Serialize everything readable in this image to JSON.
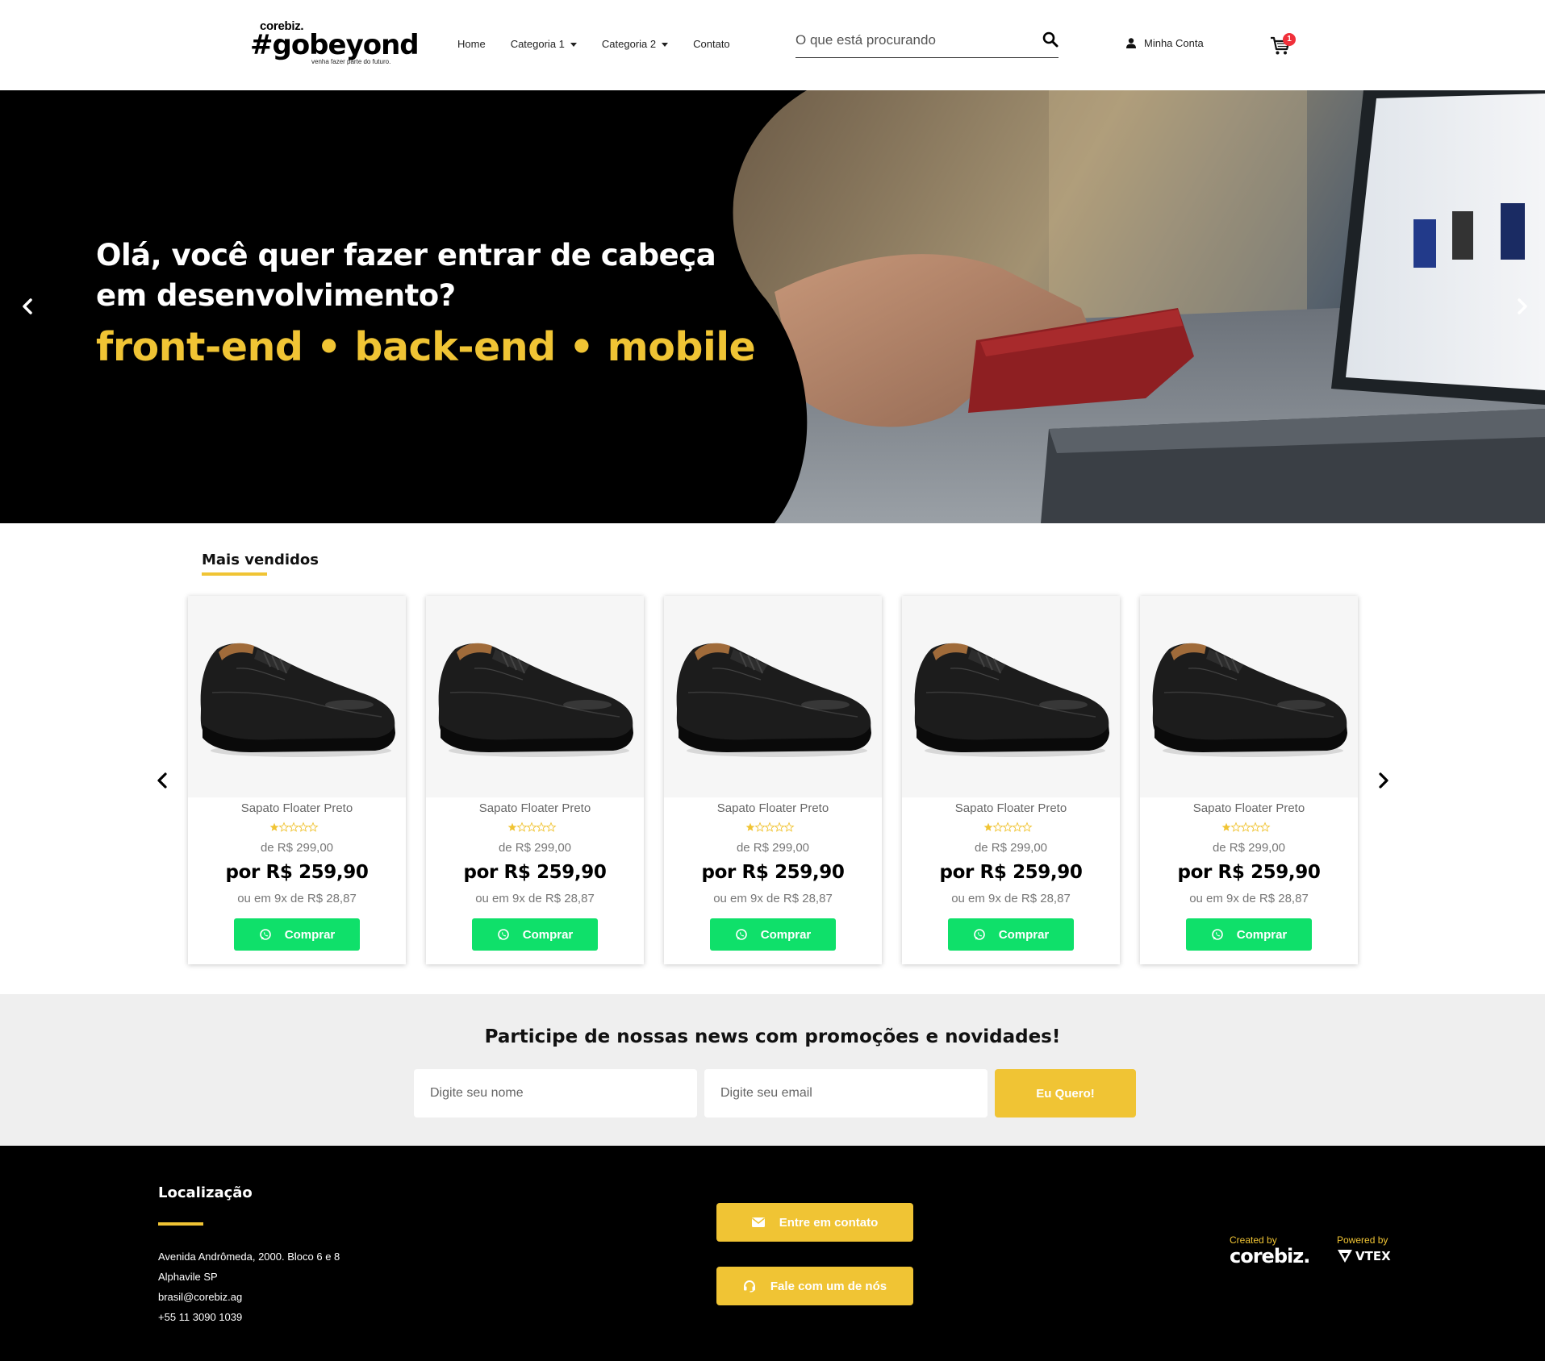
{
  "header": {
    "logo": {
      "small": "corebiz.",
      "big": "#gobeyond",
      "tagline": "venha fazer parte do futuro."
    },
    "nav": [
      {
        "label": "Home",
        "has_dropdown": false
      },
      {
        "label": "Categoria 1",
        "has_dropdown": true
      },
      {
        "label": "Categoria 2",
        "has_dropdown": true
      },
      {
        "label": "Contato",
        "has_dropdown": false
      }
    ],
    "search": {
      "placeholder": "O que está procurando",
      "icon": "search-icon"
    },
    "account": {
      "label": "Minha Conta",
      "icon": "user-icon"
    },
    "cart": {
      "icon": "cart-icon",
      "count": "1"
    }
  },
  "hero": {
    "headline": "Olá, você quer fazer entrar de cabeça em desenvolvimento?",
    "subheadline": "front-end • back-end • mobile",
    "prev_icon": "chevron-left-icon",
    "next_icon": "chevron-right-icon"
  },
  "bestsellers": {
    "title": "Mais vendidos",
    "products": [
      {
        "name": "Sapato Floater Preto",
        "rating": 1,
        "max_rating": 5,
        "list_price": "de R$ 299,00",
        "price": "por R$ 259,90",
        "installments": "ou em 9x de R$ 28,87",
        "buy_label": "Comprar"
      },
      {
        "name": "Sapato Floater Preto",
        "rating": 1,
        "max_rating": 5,
        "list_price": "de R$ 299,00",
        "price": "por R$ 259,90",
        "installments": "ou em 9x de R$ 28,87",
        "buy_label": "Comprar"
      },
      {
        "name": "Sapato Floater Preto",
        "rating": 1,
        "max_rating": 5,
        "list_price": "de R$ 299,00",
        "price": "por R$ 259,90",
        "installments": "ou em 9x de R$ 28,87",
        "buy_label": "Comprar"
      },
      {
        "name": "Sapato Floater Preto",
        "rating": 1,
        "max_rating": 5,
        "list_price": "de R$ 299,00",
        "price": "por R$ 259,90",
        "installments": "ou em 9x de R$ 28,87",
        "buy_label": "Comprar"
      },
      {
        "name": "Sapato Floater Preto",
        "rating": 1,
        "max_rating": 5,
        "list_price": "de R$ 299,00",
        "price": "por R$ 259,90",
        "installments": "ou em 9x de R$ 28,87",
        "buy_label": "Comprar"
      }
    ]
  },
  "newsletter": {
    "title": "Participe de nossas news com promoções e novidades!",
    "name_placeholder": "Digite seu nome",
    "email_placeholder": "Digite seu email",
    "submit_label": "Eu Quero!"
  },
  "footer": {
    "location_title": "Localização",
    "address_lines": [
      "Avenida Andrômeda, 2000. Bloco 6 e 8",
      "Alphavile SP",
      "brasil@corebiz.ag",
      "+55 11 3090 1039"
    ],
    "contact_button": "Entre em contato",
    "talk_button": "Fale com um de nós",
    "created_by_label": "Created by",
    "created_by_brand": "corebiz.",
    "powered_by_label": "Powered by",
    "powered_by_brand": "VTEX"
  },
  "colors": {
    "accent_yellow": "#f0c434",
    "buy_green": "#0fe06a",
    "badge_red": "#f0303a",
    "footer_bg": "#000000",
    "newsletter_bg": "#efefef"
  }
}
